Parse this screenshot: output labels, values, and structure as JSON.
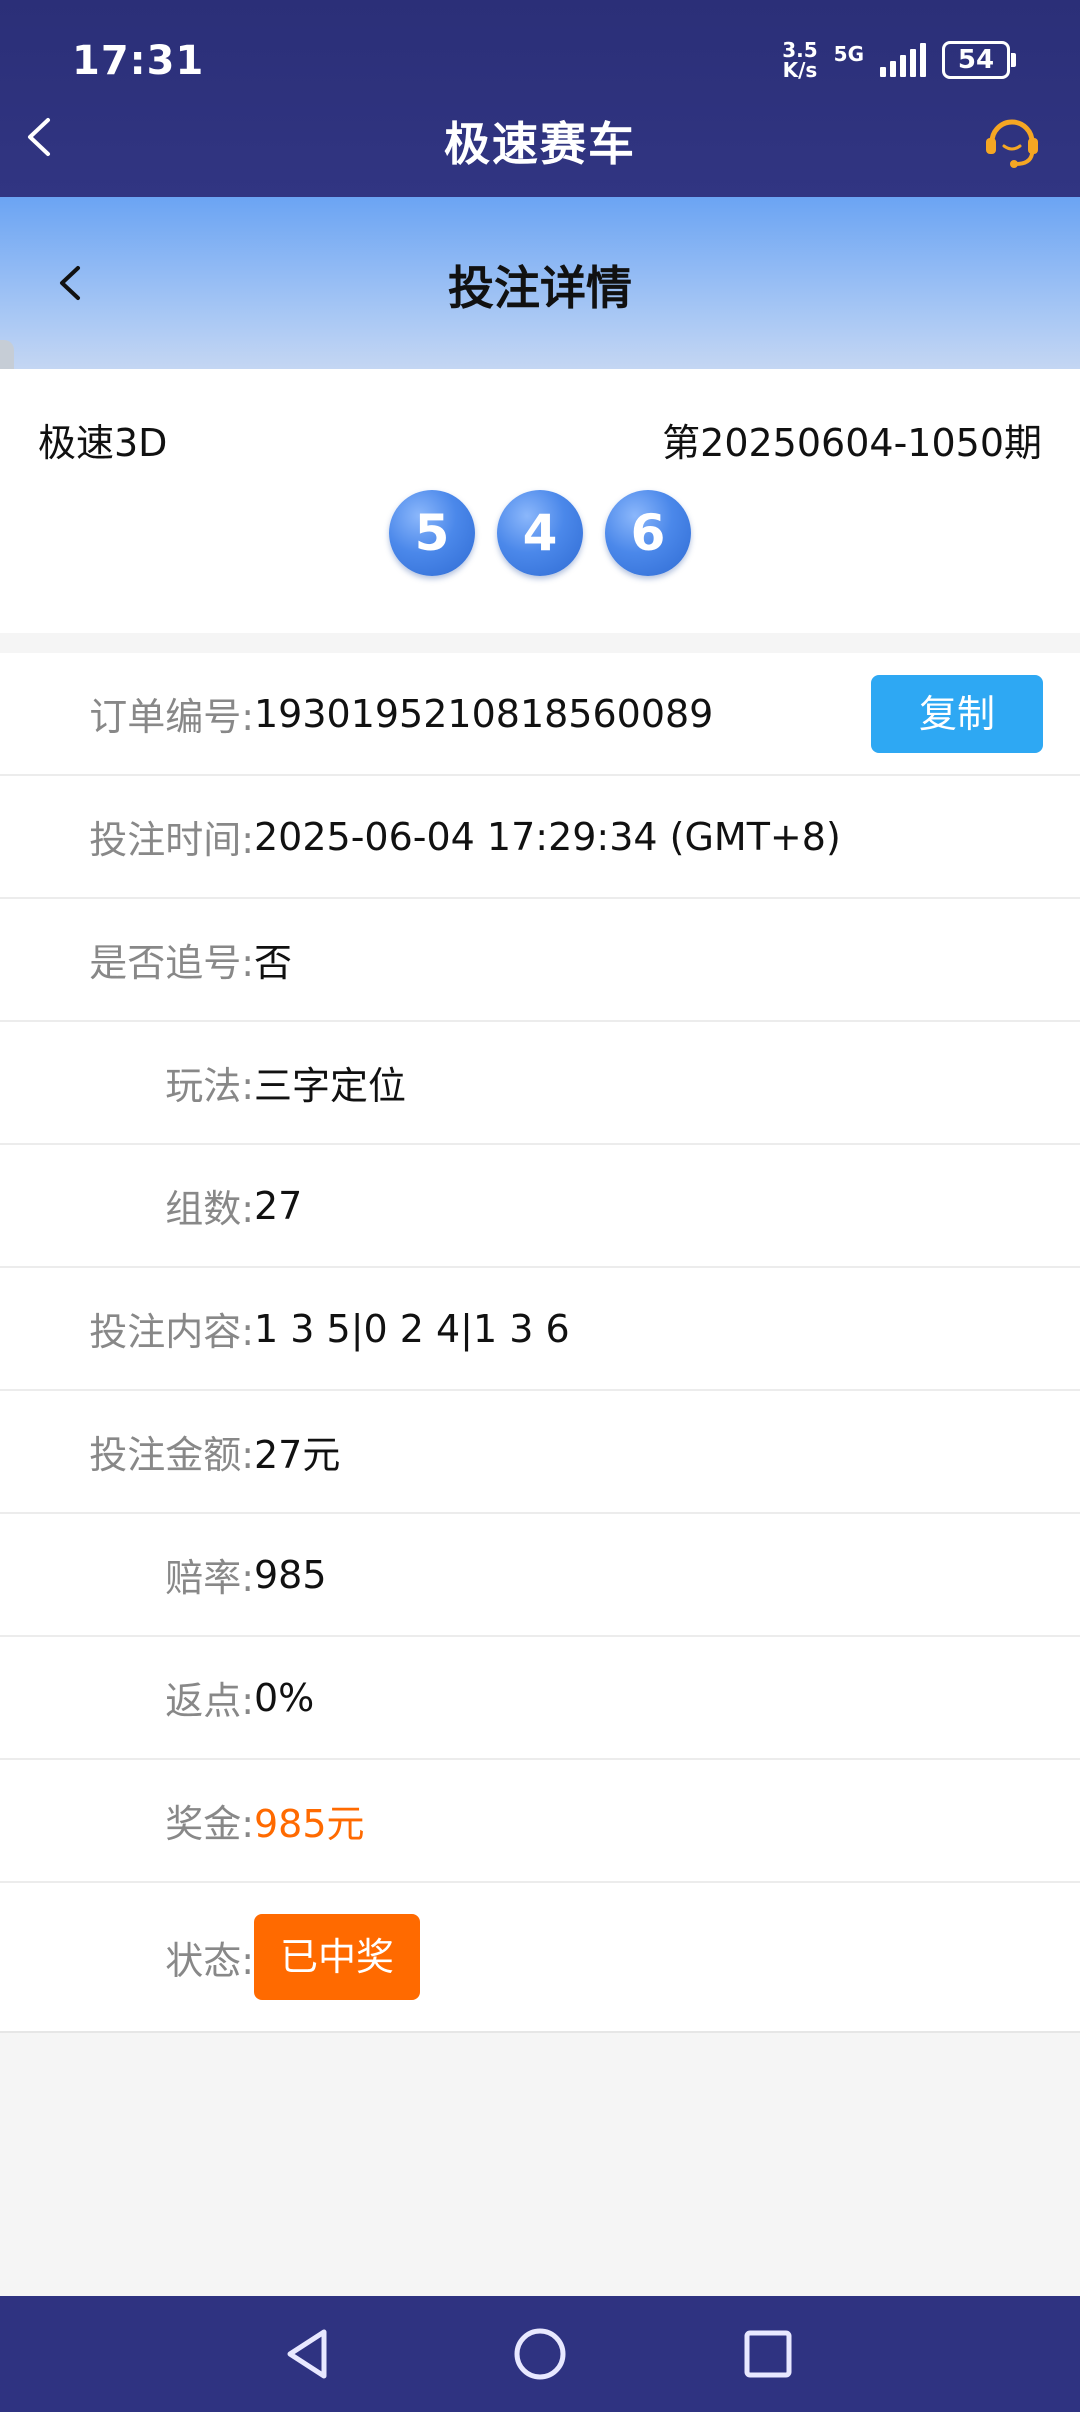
{
  "status_bar": {
    "time": "17:31",
    "net_speed_value": "3.5",
    "net_speed_unit": "K/s",
    "network": "5G",
    "battery": "54"
  },
  "header": {
    "title": "极速赛车"
  },
  "subheader": {
    "title": "投注详情"
  },
  "draw": {
    "lottery_name": "极速3D",
    "period": "第20250604-1050期",
    "numbers": [
      "5",
      "4",
      "6"
    ]
  },
  "details": {
    "order_label": "订单编号:",
    "order_value": "1930195210818560089",
    "copy_label": "复制",
    "time_label": "投注时间:",
    "time_value": "2025-06-04 17:29:34 (GMT+8)",
    "chase_label": "是否追号:",
    "chase_value": "否",
    "play_label": "玩法:",
    "play_value": "三字定位",
    "groups_label": "组数:",
    "groups_value": "27",
    "content_label": "投注内容:",
    "content_value": "1 3 5|0 2 4|1 3 6",
    "amount_label": "投注金额:",
    "amount_value": "27元",
    "odds_label": "赔率:",
    "odds_value": "985",
    "rebate_label": "返点:",
    "rebate_value": "0%",
    "prize_label": "奖金:",
    "prize_value": "985元",
    "state_label": "状态:",
    "state_value": "已中奖"
  },
  "colors": {
    "header_bg": "#2f3381",
    "accent_blue": "#2ea8f3",
    "prize_orange": "#ff6a00",
    "support_icon": "#f5a623"
  }
}
